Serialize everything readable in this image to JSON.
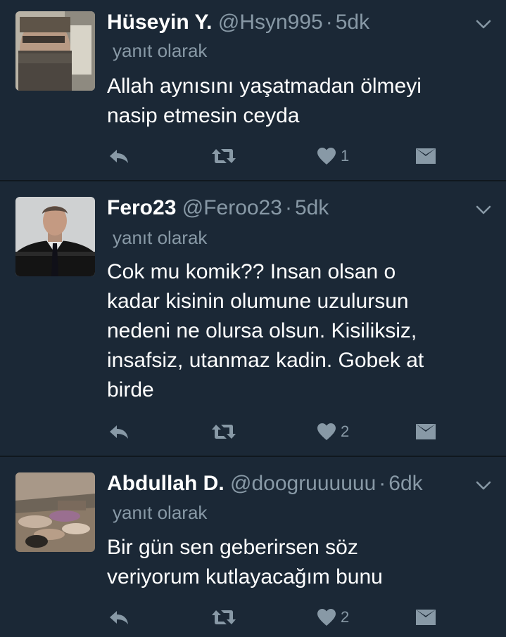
{
  "tweets": [
    {
      "name": "Hüseyin Y.",
      "handle": "@Hsyn995",
      "separator": "·",
      "time": "5dk",
      "reply_label": "yanıt olarak",
      "text_lines": [
        "Allah aynısını yaşatmadan ölmeyi",
        "nasip etmesin ceyda"
      ],
      "likes": "1"
    },
    {
      "name": "Fero23",
      "handle": "@Feroo23",
      "separator": "·",
      "time": "5dk",
      "reply_label": "yanıt olarak",
      "text_lines": [
        "Cok mu komik?? Insan olsan o",
        "kadar kisinin olumune uzulursun",
        "nedeni ne olursa olsun. Kisiliksiz,",
        "insafsiz, utanmaz kadin. Gobek at",
        "birde"
      ],
      "likes": "2"
    },
    {
      "name": "Abdullah D.",
      "handle": "@doogruuuuuu",
      "separator": "·",
      "time": "6dk",
      "reply_label": "yanıt olarak",
      "text_lines": [
        "Bir gün sen geberirsen söz",
        "veriyorum kutlayacağım bunu"
      ],
      "likes": "2"
    }
  ],
  "icons": {
    "reply": "reply-icon",
    "retweet": "retweet-icon",
    "like": "heart-icon",
    "dm": "envelope-icon",
    "menu": "chevron-down-icon"
  },
  "colors": {
    "background": "#1b2836",
    "divider": "#10171e",
    "muted": "#8899a6",
    "text": "#ffffff"
  }
}
